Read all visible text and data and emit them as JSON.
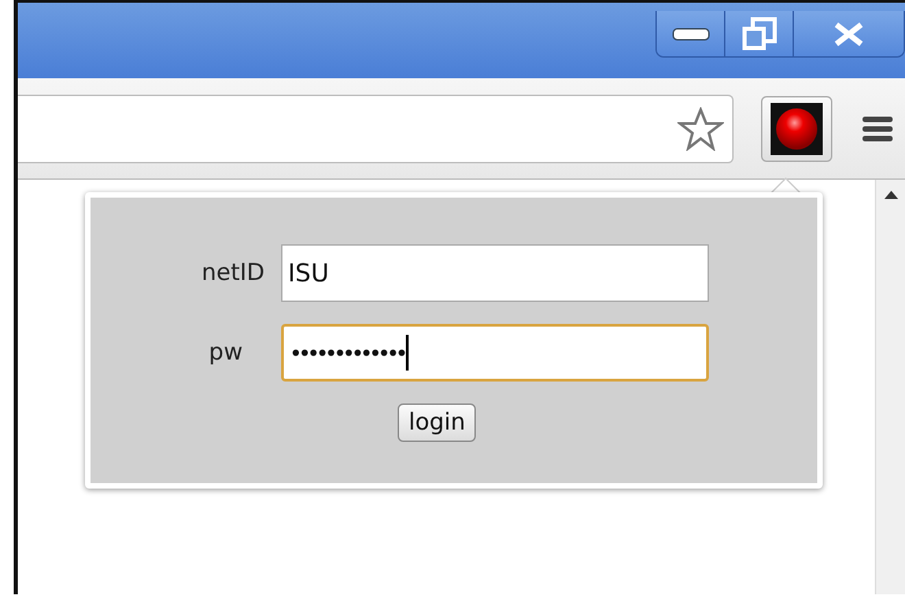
{
  "popup": {
    "fields": [
      {
        "label": "netID",
        "value": "ISU",
        "kind": "text",
        "focused": false
      },
      {
        "label": "pw",
        "value": "•••••••••••••",
        "kind": "password",
        "focused": true
      }
    ],
    "button": "login"
  }
}
